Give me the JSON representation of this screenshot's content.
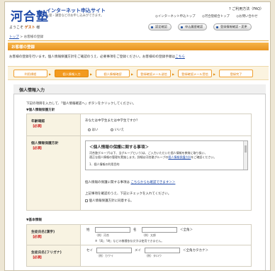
{
  "header": {
    "logo": "河合塾",
    "service_title": "インターネット申込サイト",
    "service_subtitle": "入塾・講習などのお申し込みができます。",
    "faq_link": "ご利用方法（FAQ）",
    "top_links": [
      "インターネット申込トップ",
      "河合塾総合トップ",
      "お問い合わせ"
    ]
  },
  "user_bar": {
    "prefix": "ようこそ",
    "name": "ゲスト",
    "suffix": "様"
  },
  "nav_buttons": [
    "認定確認",
    "申込履歴確認",
    "登録情報確認・変更"
  ],
  "breadcrumb": {
    "home": "トップ",
    "sep": ">",
    "current": "お客様の登録"
  },
  "page_title": "お客様の登録",
  "intro": "お客様の登録を行います。個人情報保護方針をご確認のうえ、必要事項をご登録ください。お客様IDの登録手順は",
  "intro_link": "こちら",
  "steps": [
    "利用規程",
    "個人情報入力",
    "個人情報確認",
    "登録確認メール送信",
    "登録確認メール受信",
    "登録完了"
  ],
  "panel": {
    "title": "個人情報入力",
    "instructions": "下記の項目を入力して、「個人情報確認へ」ボタンをクリックしてください。",
    "section_privacy": "▼個人情報保護方針",
    "age_label": "年齢確認",
    "required": "【必須】",
    "age_question": "あなたは中学生または中学生ですか？",
    "age_yes": "はい",
    "age_no": "いいえ",
    "policy_label": "個人情報保護方針",
    "policy_heading": "＜個人情報の保護に関する事項＞",
    "policy_text_1": "河合塾グループ(以下、当グループという)は、ご入力いただいた個人情報を教育に取り扱い、",
    "policy_text_2": "適正な個人情報の管理を実施します。詳細は河合塾グループの",
    "policy_text_link": "個人情報保護方針",
    "policy_text_3": "をご確認ください。",
    "policy_item_1": "1．個人情報の利用目的",
    "policy_contact": "個人情報の保護に関する事項は",
    "policy_contact_link": "こちらからも確認できます＞＞",
    "confirm_text": "上記事項を確認のうえ、下記にチェックを入れてください。",
    "agree_label": "個人情報保護方針に同意する。",
    "section_basic": "▼基本情報",
    "name_kanji_label": "生徒氏名(漢字)",
    "name_kana_label": "生徒氏名(フリガナ)",
    "sei": "姓",
    "mei": "名",
    "sei_kana": "セイ",
    "mei_kana": "メイ",
    "ex_kawai": "（例）河合",
    "ex_taro": "（例）太郎",
    "ex_kawai_kana": "（例）カワイ",
    "ex_taro_kana": "（例）タロウ",
    "full_width": "＜全角＞",
    "full_width_kana": "＜全角カタカナ＞",
    "note": "※「髙」「﨑」などの機種依存文字は使用できません。"
  }
}
